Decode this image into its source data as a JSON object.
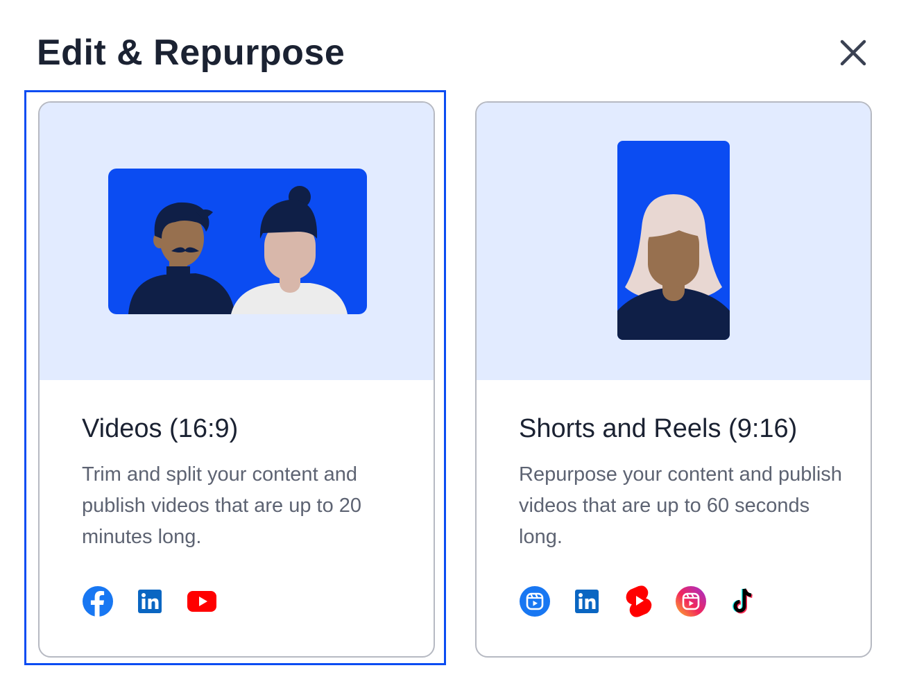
{
  "dialog": {
    "title": "Edit & Repurpose",
    "close_icon": "close-icon"
  },
  "cards": [
    {
      "title": "Videos (16:9)",
      "description": "Trim and split your content and publish videos that are up to 20 minutes long.",
      "selected": true,
      "platform_icons": [
        "facebook-icon",
        "linkedin-icon",
        "youtube-icon"
      ]
    },
    {
      "title": "Shorts and Reels (9:16)",
      "description": "Repurpose your content and publish videos that are up to 60 seconds long.",
      "selected": false,
      "platform_icons": [
        "facebook-reels-icon",
        "linkedin-icon",
        "youtube-shorts-icon",
        "instagram-reels-icon",
        "tiktok-icon"
      ]
    }
  ],
  "colors": {
    "accent": "#0b4cf2",
    "art_background": "#e2ebff",
    "card_border": "#b6b9c2",
    "title_text": "#1b2232",
    "body_text": "#5d6372"
  }
}
